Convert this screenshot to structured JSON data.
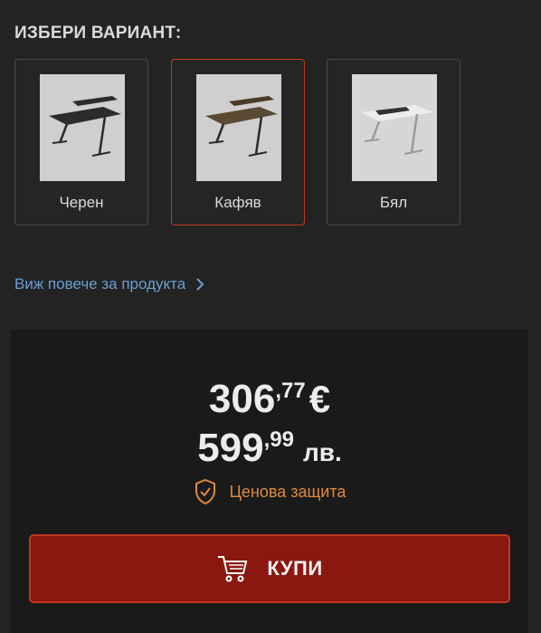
{
  "section_title": "ИЗБЕРИ ВАРИАНТ:",
  "variants": [
    {
      "label": "Черен",
      "selected": false,
      "top_color": "#2c2c2c"
    },
    {
      "label": "Кафяв",
      "selected": true,
      "top_color": "#5a4a32"
    },
    {
      "label": "Бял",
      "selected": false,
      "top_color": "#e6e6e6"
    }
  ],
  "more_link": "Виж повече за продукта",
  "price": {
    "eur_int": "306",
    "eur_dec": ",77",
    "eur_currency": "€",
    "bgn_int": "599",
    "bgn_dec": ",99",
    "bgn_currency": "лв."
  },
  "protection_label": "Ценова защита",
  "buy_label": "КУПИ",
  "colors": {
    "accent": "#c2371f",
    "button_bg": "#8a1810",
    "link": "#6a9fd2",
    "protection": "#e08a3a"
  }
}
